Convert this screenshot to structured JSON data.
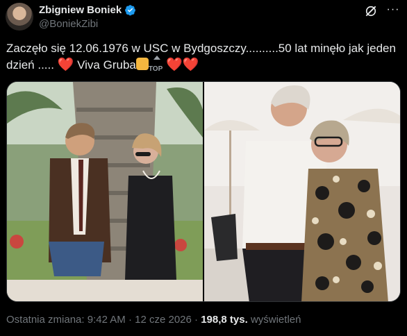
{
  "author": {
    "name": "Zbigniew Boniek",
    "handle": "@BoniekZibi",
    "verified_icon": "verified-badge-icon",
    "verified_color": "#1d9bf0"
  },
  "actions": {
    "grok_icon": "grok-icon",
    "more_label": "···"
  },
  "post": {
    "text_line1": "Zaczęło się 12.06.1976 w USC w Bydgoszczy..........50 lat minęło jak jeden",
    "text_line2_start": "dzień .....",
    "heart": "❤️",
    "text_viva": " Viva Gruba",
    "top_label": "TOP"
  },
  "media": {
    "left_image_icon": "photo-1976-couple",
    "right_image_icon": "photo-2026-couple"
  },
  "meta": {
    "edited_label": "Ostatnia zmiana:",
    "time": "9:42 AM",
    "sep": "·",
    "date": "12 cze 2026",
    "views_count": "198,8 tys.",
    "views_label": "wyświetleń"
  }
}
